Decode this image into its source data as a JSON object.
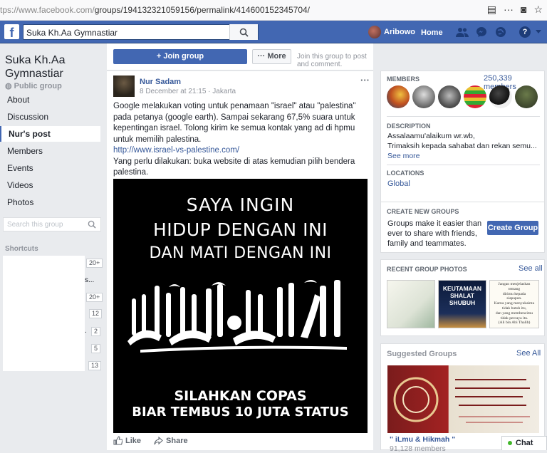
{
  "browser": {
    "url_prefix": "tps://www.facebook.com/",
    "url_rest": "groups/194132321059156/permalink/414600152345704/"
  },
  "topbar": {
    "search_value": "Suka Kh.Aa Gymnastiar",
    "user_name": "Aribowo",
    "home_label": "Home",
    "help_label": "?"
  },
  "group": {
    "name": "Suka Kh.Aa Gymnastiar",
    "privacy": "Public group",
    "nav": [
      "About",
      "Discussion",
      "Nur's post",
      "Members",
      "Events",
      "Videos",
      "Photos"
    ],
    "search_placeholder": "Search this group",
    "shortcuts_label": "Shortcuts",
    "shortcut_badges": [
      "20+",
      "20+",
      "12",
      "2",
      "5",
      "13"
    ],
    "shortcut_fragments": [
      "s...",
      "."
    ]
  },
  "joinbar": {
    "join_label": "+ Join group",
    "more_label": "··· More",
    "hint": "Join this group to post and comment."
  },
  "post": {
    "author": "Nur Sadam",
    "time": "8 December at 21:15 · Jakarta",
    "text1": "Google melakukan voting untuk penamaan \"israel\" atau \"palestina\" pada petanya (google earth). Sampai sekarang 67,5% suara untuk kepentingan israel. Tolong kirim ke semua kontak yang ad di hpmu untuk memilih palestina.",
    "link": "http://www.israel-vs-palestine.com/",
    "text2": "Yang perlu dilakukan: buka website di atas kemudian pilih bendera palestina.",
    "image_lines": [
      "SAYA INGIN",
      "HIDUP DENGAN INI",
      "DAN MATI DENGAN INI",
      "SILAHKAN COPAS",
      "BIAR TEMBUS 10 JUTA STATUS"
    ],
    "like_label": "Like",
    "share_label": "Share"
  },
  "members": {
    "title": "MEMBERS",
    "count": "250,339 members",
    "desc_title": "DESCRIPTION",
    "desc_line1": "Assalaamu'alaikum wr.wb,",
    "desc_line2": "Trimaksih kepada sahabat dan rekan semu...",
    "see_more": "See more",
    "loc_title": "LOCATIONS",
    "location": "Global"
  },
  "create_group": {
    "title": "CREATE NEW GROUPS",
    "text": "Groups make it easier than ever to share with friends, family and teammates.",
    "button": "Create Group"
  },
  "recent_photos": {
    "title": "RECENT GROUP PHOTOS",
    "see_all": "See all",
    "photo2_caption": "KEUTAMAAN SHALAT SHUBUH",
    "photo3_lines": [
      "Jangan menjelaskan",
      "tentang",
      "dirimu kepada",
      "siapapun.",
      "Karna yang menyukaimu",
      "tidak butuh itu,",
      "dan yang membencimu",
      "tidak percaya itu.",
      "(Ali bin Abi Thalib)"
    ]
  },
  "suggested": {
    "title": "Suggested Groups",
    "see_all": "See All",
    "name": "\" iLmu & Hikmah \"",
    "members": "91,128 members"
  },
  "chat": {
    "label": "Chat"
  },
  "colors": {
    "brand": "#4267b2",
    "link": "#365899",
    "online": "#42b72a"
  }
}
